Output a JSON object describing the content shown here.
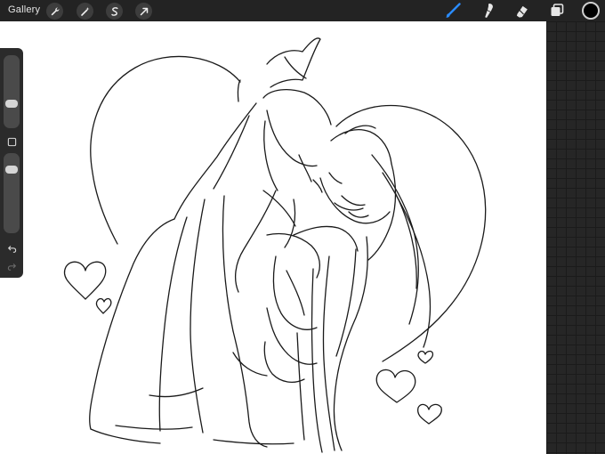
{
  "toolbar": {
    "gallery_label": "Gallery",
    "left_tools": [
      "wrench-icon",
      "magic-wand-icon",
      "selection-icon",
      "transform-arrow-icon"
    ],
    "right_tools": [
      "brush-icon",
      "smudge-icon",
      "eraser-icon",
      "layers-icon"
    ],
    "active_tool": "brush",
    "accent_color": "#2a8cff",
    "current_color": "#000000"
  },
  "sidebar": {
    "brush_size_level": 0.3,
    "opacity_level": 0.85,
    "modify_button": "square-modify-icon",
    "undo_icon": "undo-arrow-icon",
    "redo_icon": "redo-arrow-icon"
  },
  "canvas": {
    "background": "#ffffff",
    "artwork": "line-art-sketch"
  }
}
